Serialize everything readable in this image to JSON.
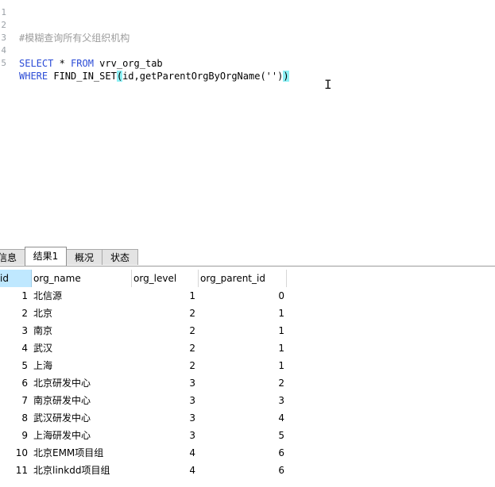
{
  "editor": {
    "lines": [
      {
        "number": "1",
        "comment": ""
      },
      {
        "number": "2",
        "comment": "#模糊查询所有父组织机构"
      },
      {
        "number": "3",
        "comment": ""
      },
      {
        "number": "4",
        "kw1": "SELECT",
        "p1": " * ",
        "kw2": "FROM",
        "p2": " vrv_org_tab"
      },
      {
        "number": "5",
        "kw1": "WHERE",
        "p1": " FIND_IN_SET",
        "hl_open": "(",
        "p2": "id,getParentOrgByOrgName('')",
        "hl_close": ")"
      }
    ]
  },
  "tabs": [
    {
      "label": "信息",
      "active": false
    },
    {
      "label": "结果1",
      "active": true
    },
    {
      "label": "概况",
      "active": false
    },
    {
      "label": "状态",
      "active": false
    }
  ],
  "grid": {
    "columns": [
      "id",
      "org_name",
      "org_level",
      "org_parent_id"
    ],
    "rows": [
      [
        "1",
        "北信源",
        "1",
        "0"
      ],
      [
        "2",
        "北京",
        "2",
        "1"
      ],
      [
        "3",
        "南京",
        "2",
        "1"
      ],
      [
        "4",
        "武汉",
        "2",
        "1"
      ],
      [
        "5",
        "上海",
        "2",
        "1"
      ],
      [
        "6",
        "北京研发中心",
        "3",
        "2"
      ],
      [
        "7",
        "南京研发中心",
        "3",
        "3"
      ],
      [
        "8",
        "武汉研发中心",
        "3",
        "4"
      ],
      [
        "9",
        "上海研发中心",
        "3",
        "5"
      ],
      [
        "10",
        "北京EMM项目组",
        "4",
        "6"
      ],
      [
        "11",
        "北京linkdd项目组",
        "4",
        "6"
      ]
    ]
  },
  "colors": {
    "keyword": "#2b4bd6",
    "comment": "#9c9c9c",
    "bracket_highlight": "#8ef1f5",
    "selected_header": "#bfe8ff"
  }
}
